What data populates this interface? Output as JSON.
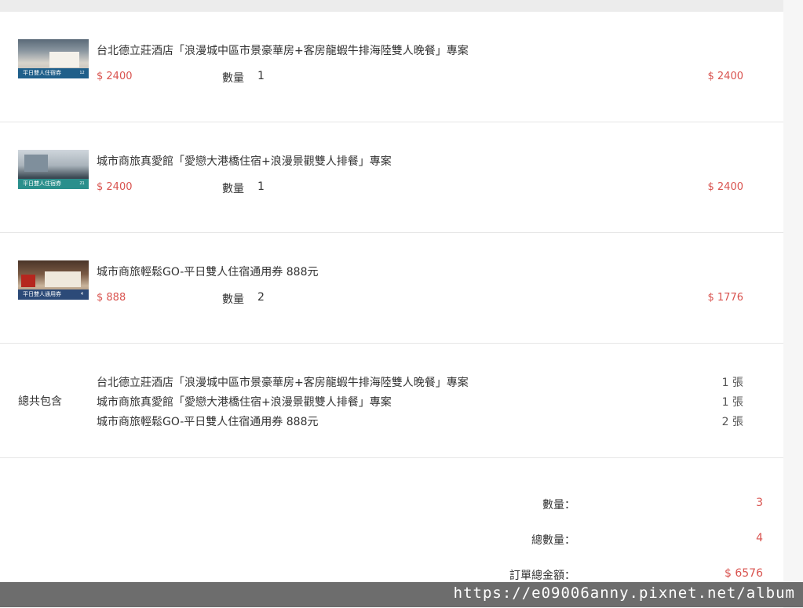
{
  "items": [
    {
      "title": "台北德立莊酒店「浪漫城中區市景豪華房+客房龍蝦牛排海陸雙人晚餐」專案",
      "price": "$ 2400",
      "qty_label": "數量",
      "qty": "1",
      "subtotal": "$ 2400",
      "thumb_caption": "平日雙人住宿券",
      "thumb_num": "12"
    },
    {
      "title": "城市商旅真愛館「愛戀大港橋住宿+浪漫景觀雙人排餐」專案",
      "price": "$ 2400",
      "qty_label": "數量",
      "qty": "1",
      "subtotal": "$ 2400",
      "thumb_caption": "平日雙人住宿券",
      "thumb_num": "21"
    },
    {
      "title": "城市商旅輕鬆GO-平日雙人住宿通用券 888元",
      "price": "$ 888",
      "qty_label": "數量",
      "qty": "2",
      "subtotal": "$ 1776",
      "thumb_caption": "平日雙人通用券",
      "thumb_num": "4"
    }
  ],
  "summary": {
    "label": "總共包含",
    "rows": [
      {
        "name": "台北德立莊酒店「浪漫城中區市景豪華房+客房龍蝦牛排海陸雙人晚餐」專案",
        "count": "1 張"
      },
      {
        "name": "城市商旅真愛館「愛戀大港橋住宿+浪漫景觀雙人排餐」專案",
        "count": "1 張"
      },
      {
        "name": "城市商旅輕鬆GO-平日雙人住宿通用券 888元",
        "count": "2 張"
      }
    ]
  },
  "totals": {
    "qty_label": "數量：",
    "qty": "3",
    "total_qty_label": "總數量：",
    "total_qty": "4",
    "amount_label": "訂單總金額：",
    "amount": "$ 6576"
  },
  "watermark": "https://e09006anny.pixnet.net/album"
}
